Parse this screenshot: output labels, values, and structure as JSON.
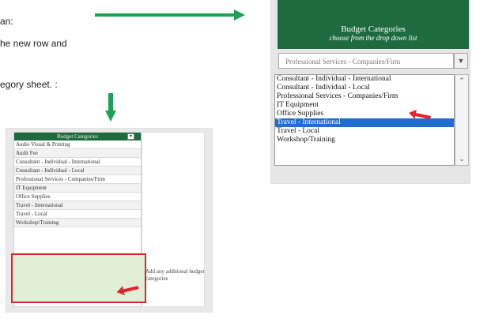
{
  "instructions": {
    "line1": "an:",
    "line2": "he new row and",
    "line3": "egory sheet. :"
  },
  "dropdown_view": {
    "header_title": "Budget Categories",
    "header_subtitle": "choose from the drop down list",
    "selected_value": "Professional Services - Companies/Firm",
    "options": [
      "Consultant - Individual - International",
      "Consultant - Individual - Local",
      "Professional Services - Companies/Firm",
      "IT Equipment",
      "Office Supplies",
      "Travel - International",
      "Travel - Local",
      "Workshop/Training"
    ],
    "highlighted_option": "Travel - International"
  },
  "sheet_view": {
    "header": "Budget Categories",
    "rows": [
      "Audio Visual & Printing",
      "Audit Fee",
      "Consultant - Individual - International",
      "Consultant - Individual - Local",
      "Professional Services - Companies/Firm",
      "IT Equipment",
      "Office Supplies",
      "Travel - International",
      "Travel - Local",
      "Workshop/Training"
    ],
    "note": "Add any additional budget categories"
  },
  "colors": {
    "header_green": "#1e6b3f",
    "arrow_green": "#1aa356",
    "selection_blue": "#1f6fd0",
    "highlight_red": "#e0242b",
    "new_rows_fill": "#dfeed4"
  }
}
